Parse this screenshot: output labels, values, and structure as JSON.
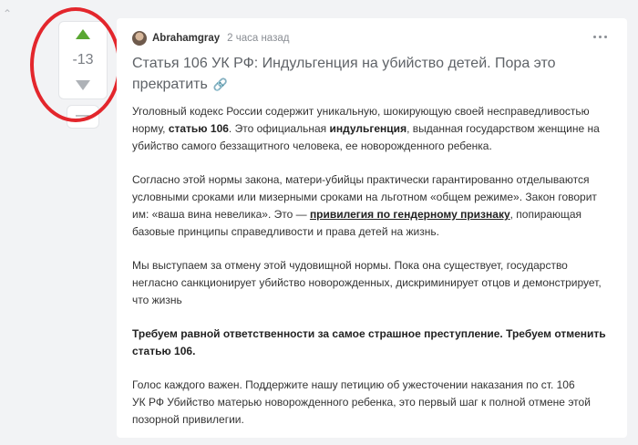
{
  "vote": {
    "count": "-13"
  },
  "post": {
    "author": "Abrahamgray",
    "time": "2 часа назад",
    "title": "Статья 106 УК РФ: Индульгенция на убийство детей. Пора это прекратить",
    "link_icon": "🔗",
    "p1": {
      "t1": "Уголовный кодекс России содержит уникальную, шокирующую своей несправедливостью норму, ",
      "b1": "статью 106",
      "t2": ". Это официальная ",
      "b2": "индульгенция",
      "t3": ", выданная государством женщине на убийство самого беззащитного человека, ее новорожденного ребенка."
    },
    "p2": {
      "t1": "Согласно этой нормы закона, матери-убийцы практически гарантированно отделываются условными сроками или мизерными сроками на льготном «общем режиме». Закон говорит им: «ваша вина невелика». Это — ",
      "b1": "привилегия по гендерному признаку",
      "t2": ", попирающая базовые принципы справедливости и права детей на жизнь."
    },
    "p3": "Мы выступаем за отмену этой чудовищной нормы. Пока она существует, государство негласно санкционирует убийство новорожденных, дискриминирует отцов и демонстрирует, что жизнь",
    "p4": "Требуем равной ответственности за самое страшное преступление. Требуем отменить статью 106.",
    "p5": {
      "l1": "Голос каждого важен. Поддержите нашу петицию об ужесточении наказания по ст. 106",
      "l2": "УК РФ Убийство матерью новорожденного ребенка, это первый шаг к полной отмене этой",
      "l3": "позорной привилегии."
    }
  }
}
